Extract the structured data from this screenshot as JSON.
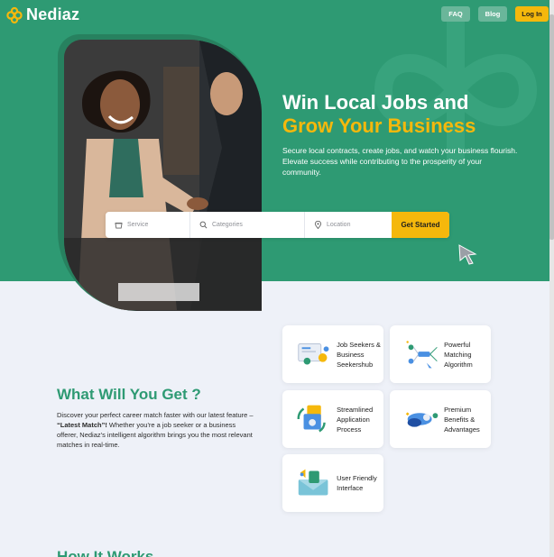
{
  "brand": {
    "name": "Nediaz"
  },
  "nav": {
    "faq": "FAQ",
    "blog": "Blog",
    "login": "Log In"
  },
  "hero": {
    "title_line1": "Win Local Jobs and",
    "title_line2": "Grow Your Business",
    "subtitle": "Secure local contracts, create jobs, and watch your business flourish. Elevate success while contributing to the prosperity of your community."
  },
  "search": {
    "service_placeholder": "Service",
    "category_placeholder": "Categories",
    "location_placeholder": "Location",
    "button": "Get Started"
  },
  "features": {
    "title": "What Will You Get ?",
    "desc_before": "Discover your perfect career match faster with our latest feature – ",
    "desc_bold": "“Latest Match”!",
    "desc_after": " Whether you're a job seeker or a business offerer, Nediaz's intelligent algorithm brings you the most relevant matches in real-time.",
    "cards": [
      {
        "label": "Job Seekers & Business Seekershub",
        "icon": "job-seekers-icon"
      },
      {
        "label": "Powerful Matching Algorithm",
        "icon": "matching-algorithm-icon"
      },
      {
        "label": "Streamlined Application Process",
        "icon": "application-process-icon"
      },
      {
        "label": "Premium Benefits & Advantages",
        "icon": "premium-benefits-icon"
      },
      {
        "label": "User Friendly Interface",
        "icon": "user-friendly-icon"
      }
    ]
  },
  "next_section": {
    "title": "How It Works"
  },
  "colors": {
    "primary": "#2e9a73",
    "accent": "#f5b80c",
    "background": "#eef1f8"
  }
}
